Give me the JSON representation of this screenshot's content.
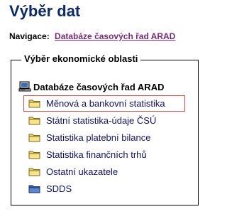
{
  "page": {
    "title": "Výběr dat"
  },
  "nav": {
    "label": "Navigace:",
    "link": "Databáze časových řad ARAD"
  },
  "section": {
    "legend": "Výběr ekonomické oblasti"
  },
  "tree": {
    "root": {
      "label": "Databáze časových řad ARAD",
      "icon": "computer-icon"
    },
    "items": [
      {
        "label": "Měnová a bankovní statistika",
        "icon": "folder-icon",
        "highlighted": true
      },
      {
        "label": "Státní statistika-údaje ČSÚ",
        "icon": "folder-icon"
      },
      {
        "label": "Statistika platební bilance",
        "icon": "folder-icon"
      },
      {
        "label": "Statistika finančních trhů",
        "icon": "folder-icon"
      },
      {
        "label": "Ostatní ukazatele",
        "icon": "folder-icon"
      },
      {
        "label": "SDDS",
        "icon": "folder-blue-icon"
      }
    ]
  },
  "colors": {
    "title": "#0b2b6b",
    "link": "#7a2a7a",
    "item_text": "#10106e",
    "folder_yellow": "#f2d95c",
    "folder_blue": "#3a63b8",
    "highlight": "#e34b4b"
  }
}
